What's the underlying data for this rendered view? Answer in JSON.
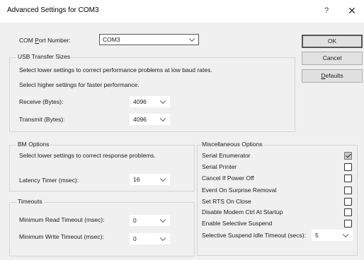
{
  "window": {
    "title": "Advanced Settings for COM3",
    "help_glyph": "?",
    "close_glyph": "✕"
  },
  "port": {
    "label_pre": "COM ",
    "label_accel": "P",
    "label_post": "ort Number:",
    "value": "COM3"
  },
  "buttons": {
    "ok": "OK",
    "cancel": "Cancel",
    "defaults_accel": "D",
    "defaults_rest": "efaults"
  },
  "usb": {
    "title": "USB Transfer Sizes",
    "line1": "Select lower settings to correct performance problems at low baud rates.",
    "line2": "Select higher settings for faster performance.",
    "receive_label": "Receive (Bytes):",
    "receive_value": "4096",
    "transmit_label": "Transmit (Bytes):",
    "transmit_value": "4096"
  },
  "bm": {
    "title": "BM Options",
    "line1": "Select lower settings to correct response problems.",
    "latency_label": "Latency Timer (msec):",
    "latency_value": "16"
  },
  "timeouts": {
    "title": "Timeouts",
    "read_label": "Minimum Read Timeout (msec):",
    "read_value": "0",
    "write_label": "Minimum Write Timeout (msec):",
    "write_value": "0"
  },
  "misc": {
    "title": "Miscellaneous Options",
    "options": [
      {
        "label": "Serial Enumerator",
        "checked": true
      },
      {
        "label": "Serial Printer",
        "checked": false
      },
      {
        "label": "Cancel If Power Off",
        "checked": false
      },
      {
        "label": "Event On Surprise Removal",
        "checked": false
      },
      {
        "label": "Set RTS On Close",
        "checked": false
      },
      {
        "label": "Disable Modem Ctrl At Startup",
        "checked": false
      },
      {
        "label": "Enable Selective Suspend",
        "checked": false
      }
    ],
    "idle_label": "Selective Suspend Idle Timeout (secs):",
    "idle_value": "5"
  }
}
